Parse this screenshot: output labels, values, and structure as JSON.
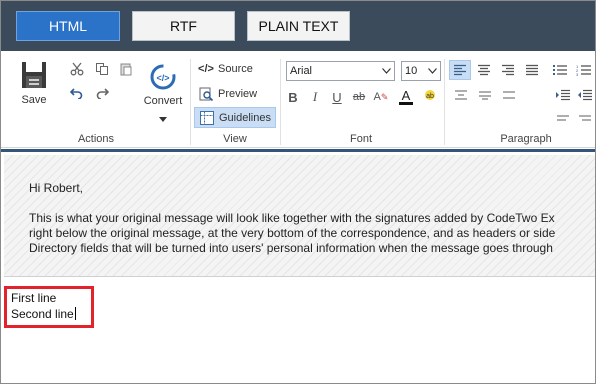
{
  "format_tabs": [
    {
      "label": "HTML",
      "active": true
    },
    {
      "label": "RTF",
      "active": false
    },
    {
      "label": "PLAIN TEXT",
      "active": false
    }
  ],
  "ribbon": {
    "actions": {
      "group_label": "Actions",
      "save_label": "Save",
      "convert_label": "Convert"
    },
    "view": {
      "group_label": "View",
      "source_label": "Source",
      "preview_label": "Preview",
      "guidelines_label": "Guidelines",
      "active": "Guidelines"
    },
    "font": {
      "group_label": "Font",
      "font_name": "Arial",
      "font_size": "10"
    },
    "paragraph": {
      "group_label": "Paragraph",
      "active_alignment": "left"
    }
  },
  "editor": {
    "signature_lines": [
      "Hi Robert,",
      "This is what your original message will look like together with the signatures added by CodeTwo Ex",
      "right below the original message, at the very bottom of the correspondence, and as headers or side",
      "Directory fields that will be turned into users' personal information when the message goes through"
    ],
    "body_lines": [
      "First line",
      "Second line"
    ]
  },
  "colors": {
    "tabbar": "#3c4b5c",
    "active_tab": "#2b73c8",
    "highlight": "#e3232c",
    "accent_line": "#33557a"
  }
}
